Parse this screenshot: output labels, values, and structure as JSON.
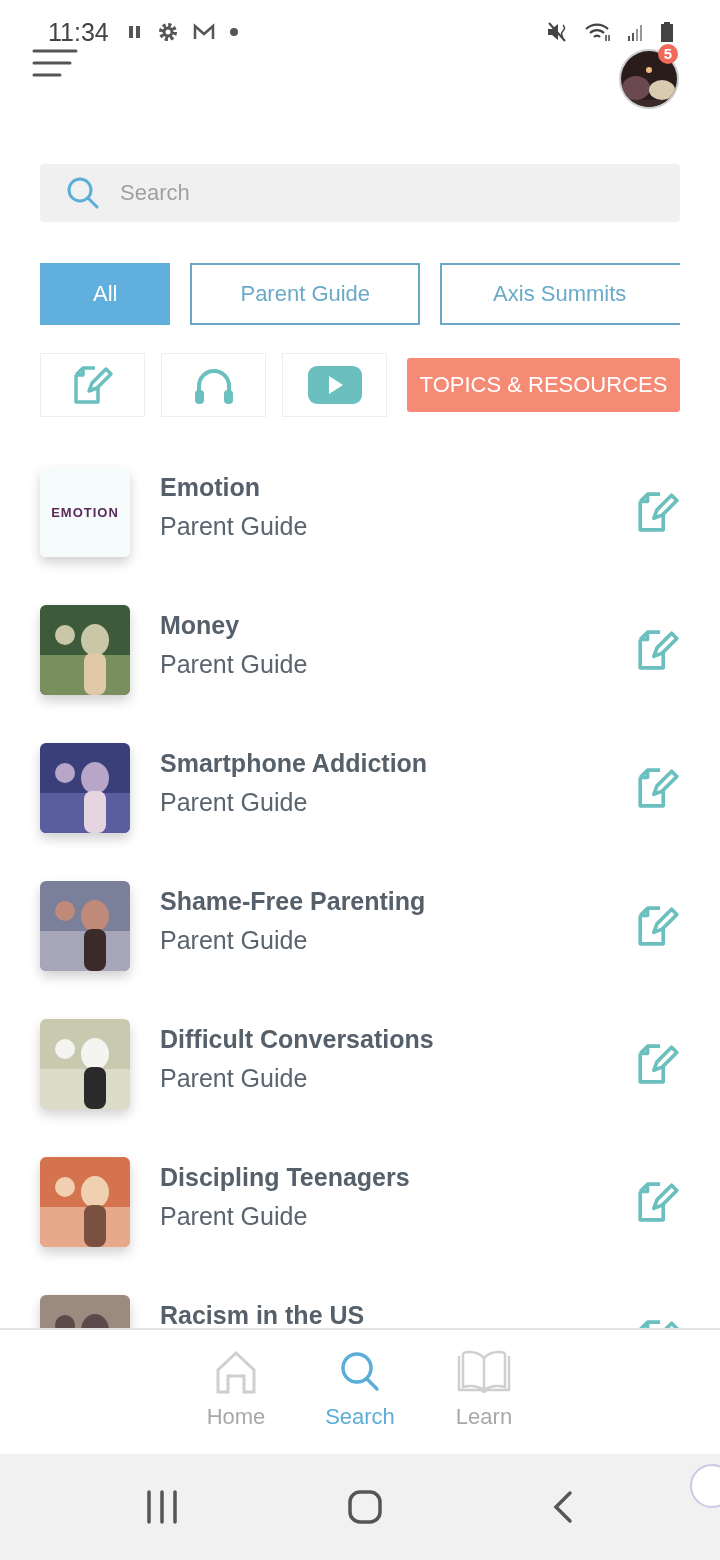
{
  "status_bar": {
    "time": "11:34"
  },
  "header": {
    "notification_count": "5"
  },
  "search": {
    "placeholder": "Search"
  },
  "filter_tabs": [
    {
      "label": "All",
      "selected": true
    },
    {
      "label": "Parent Guide",
      "selected": false
    },
    {
      "label": "Axis Summits",
      "selected": false
    }
  ],
  "media_filters": [
    {
      "kind": "guide"
    },
    {
      "kind": "audio"
    },
    {
      "kind": "video"
    }
  ],
  "topics_button": {
    "label": "TOPICS & RESOURCES"
  },
  "results": [
    {
      "title": "Emotion",
      "subtitle": "Parent Guide",
      "thumb_text": "EMOTION"
    },
    {
      "title": "Money",
      "subtitle": "Parent Guide",
      "kind": "picture"
    },
    {
      "title": "Smartphone Addiction",
      "subtitle": "Parent Guide",
      "kind": "picture"
    },
    {
      "title": "Shame-Free Parenting",
      "subtitle": "Parent Guide",
      "kind": "picture"
    },
    {
      "title": "Difficult Conversations",
      "subtitle": "Parent Guide",
      "kind": "picture"
    },
    {
      "title": "Discipling Teenagers",
      "subtitle": "Parent Guide",
      "kind": "picture"
    },
    {
      "title": "Racism in the US",
      "kind": "picture"
    }
  ],
  "bottom_nav": [
    {
      "label": "Home",
      "kind": "home",
      "selected": false
    },
    {
      "label": "Search",
      "kind": "search",
      "selected": true
    },
    {
      "label": "Learn",
      "kind": "learn",
      "selected": false
    }
  ]
}
